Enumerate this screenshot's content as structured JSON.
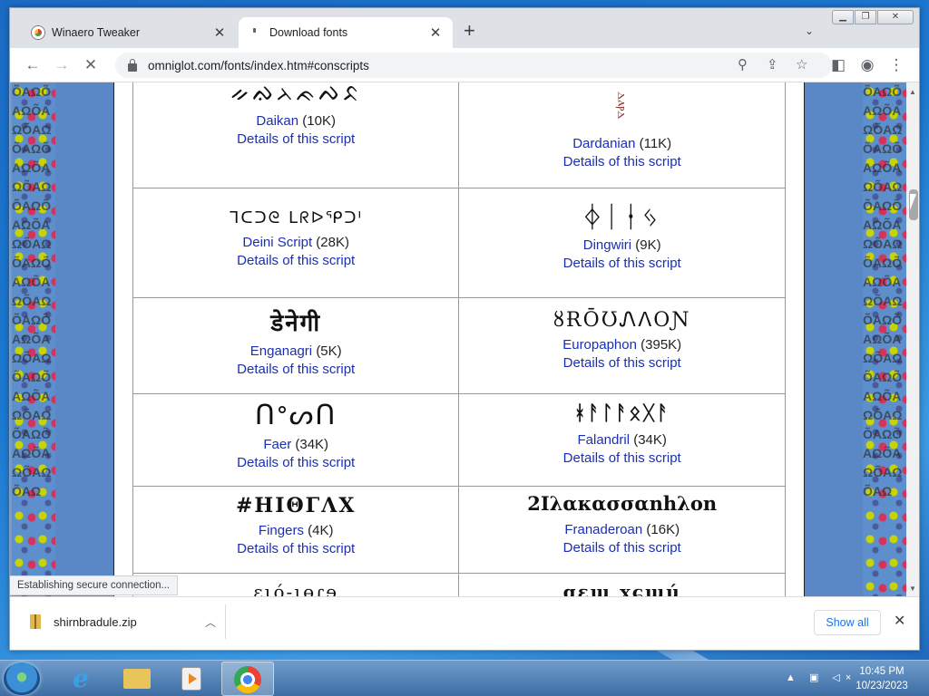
{
  "browser": {
    "tabs": [
      {
        "label": "Winaero Tweaker",
        "icon": "winaero-icon",
        "active": false
      },
      {
        "label": "Download fonts",
        "icon": "loading-icon",
        "active": true
      }
    ],
    "url": "omniglot.com/fonts/index.htm#conscripts",
    "status": "Establishing secure connection..."
  },
  "scripts": [
    {
      "sample": "ᨀᨁᨂᨃᨄᨅ",
      "name": "Daikan",
      "size": "(10K)",
      "details": "Details of this script"
    },
    {
      "sample": "ⲇⲁⲣⲇ",
      "name": "Dardanian",
      "size": "(11K)",
      "details": "Details of this script"
    },
    {
      "sample": "ᒣᑕᑐᘓ ᒪᖇᐅᕿᑐᑊ",
      "name": "Deini Script",
      "size": "(28K)",
      "details": "Details of this script"
    },
    {
      "sample": "ᛄᛁᛂᛃ",
      "name": "Dingwiri",
      "size": "(9K)",
      "details": "Details of this script"
    },
    {
      "sample": "डेनेगी",
      "name": "Enganagri",
      "size": "(5K)",
      "details": "Details of this script"
    },
    {
      "sample": "ȣɌŌƱᏁᐱOƝ",
      "name": "Europaphon",
      "size": "(395K)",
      "details": "Details of this script"
    },
    {
      "sample": "ᑎᐤᔕᑎ",
      "name": "Faer",
      "size": "(34K)",
      "details": "Details of this script"
    },
    {
      "sample": "ᚼᚨᛚᚨᛟᚷᚨ",
      "name": "Falandril",
      "size": "(34K)",
      "details": "Details of this script"
    },
    {
      "sample": "#ΗΙΘΓΛΧ",
      "name": "Fingers",
      "size": "(4K)",
      "details": "Details of this script"
    },
    {
      "sample": "2Ιλακασσαnhλon",
      "name": "Franaderoan",
      "size": "(16K)",
      "details": "Details of this script"
    },
    {
      "sample": "ɛɩó-ɩɵɾɘ",
      "name": "",
      "size": "",
      "details": ""
    },
    {
      "sample": "ɑɛɰ ɣɕɰú",
      "name": "",
      "size": "",
      "details": ""
    }
  ],
  "downloads": {
    "file": "shirnbradule.zip",
    "show_all": "Show all"
  },
  "taskbar": {
    "time": "10:45 PM",
    "date": "10/23/2023"
  }
}
